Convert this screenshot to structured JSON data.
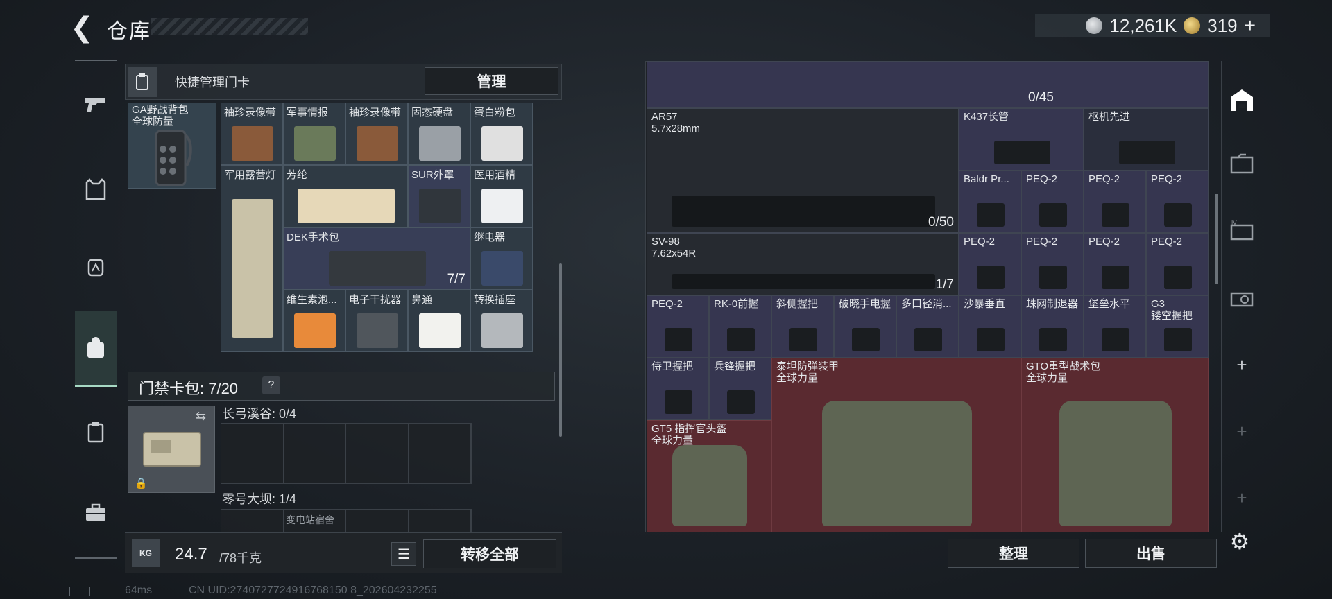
{
  "header": {
    "title": "仓库",
    "currency_silver": "12,261K",
    "currency_gold": "319",
    "currency_add": "+"
  },
  "left_nav": {
    "items": [
      {
        "icon": "pistol-icon"
      },
      {
        "icon": "vest-icon"
      },
      {
        "icon": "helmet-icon"
      },
      {
        "icon": "backpack-icon",
        "active": true
      },
      {
        "icon": "keycard-case-icon"
      },
      {
        "icon": "toolbox-icon"
      }
    ]
  },
  "quick": {
    "label": "快捷管理门卡",
    "manage": "管理"
  },
  "backpack": {
    "name": "GA野战背包",
    "sub": "全球防量"
  },
  "grid_items": [
    {
      "label": "袖珍录像带"
    },
    {
      "label": "军事情报"
    },
    {
      "label": "袖珍录像带"
    },
    {
      "label": "固态硬盘"
    },
    {
      "label": "蛋白粉包"
    },
    {
      "label": "军用露营灯"
    },
    {
      "label": "芳纶"
    },
    {
      "label": "SUR外罩"
    },
    {
      "label": "医用酒精"
    },
    {
      "label": "DEK手术包",
      "count": "7/7"
    },
    {
      "label": "继电器"
    },
    {
      "label": "维生素泡..."
    },
    {
      "label": "电子干扰器"
    },
    {
      "label": "鼻通"
    },
    {
      "label": "转换插座"
    }
  ],
  "doorcard": {
    "label": "门禁卡包: 7/20",
    "help": "?",
    "maps": [
      {
        "label": "长弓溪谷: 0/4"
      },
      {
        "label": "零号大坝: 1/4",
        "sub": "变电站宿舍"
      }
    ]
  },
  "footer_left": {
    "weight_icon": "KG",
    "weight": "24.7",
    "weight_max": "/78千克",
    "transfer_all": "转移全部"
  },
  "stash": {
    "top_count": "0/45",
    "items": [
      {
        "label": "AR57",
        "sub": "5.7x28mm",
        "count": "0/50"
      },
      {
        "label": "K437长管"
      },
      {
        "label": "枢机先进"
      },
      {
        "label": "Baldr Pr..."
      },
      {
        "label": "PEQ-2"
      },
      {
        "label": "PEQ-2"
      },
      {
        "label": "PEQ-2"
      },
      {
        "label": "SV-98",
        "sub": "7.62x54R",
        "count": "1/7"
      },
      {
        "label": "PEQ-2"
      },
      {
        "label": "PEQ-2"
      },
      {
        "label": "PEQ-2"
      },
      {
        "label": "PEQ-2"
      },
      {
        "label": "PEQ-2"
      },
      {
        "label": "RK-0前握"
      },
      {
        "label": "斜侧握把"
      },
      {
        "label": "破晓手电握"
      },
      {
        "label": "多口径消..."
      },
      {
        "label": "沙暴垂直"
      },
      {
        "label": "蛛网制退器"
      },
      {
        "label": "堡垒水平"
      },
      {
        "label": "G3",
        "sub": "镂空握把"
      },
      {
        "label": "侍卫握把"
      },
      {
        "label": "兵锋握把"
      },
      {
        "label": "泰坦防弹装甲",
        "sub": "全球力量"
      },
      {
        "label": "GTO重型战术包",
        "sub": "全球力量"
      },
      {
        "label": "GT5 指挥官头盔",
        "sub": "全球力量"
      }
    ],
    "sort": "整理",
    "sell": "出售"
  },
  "right_nav": {
    "items": [
      {
        "icon": "warehouse-icon",
        "active": true
      },
      {
        "icon": "folder-icon"
      },
      {
        "icon": "tab-iv-icon"
      },
      {
        "icon": "tab-camera-icon"
      },
      {
        "icon": "add-icon",
        "text": "+"
      },
      {
        "icon": "add-icon",
        "text": "+"
      },
      {
        "icon": "add-icon",
        "text": "+"
      }
    ]
  },
  "status": {
    "ping": "64ms",
    "uid": "CN UID:2740727724916768150 8_202604232255"
  },
  "colors": {
    "accent": "#a7d9c4",
    "red_slot": "#5a2a30",
    "purple_slot": "#363650",
    "blue_slot": "#2f3a44"
  }
}
